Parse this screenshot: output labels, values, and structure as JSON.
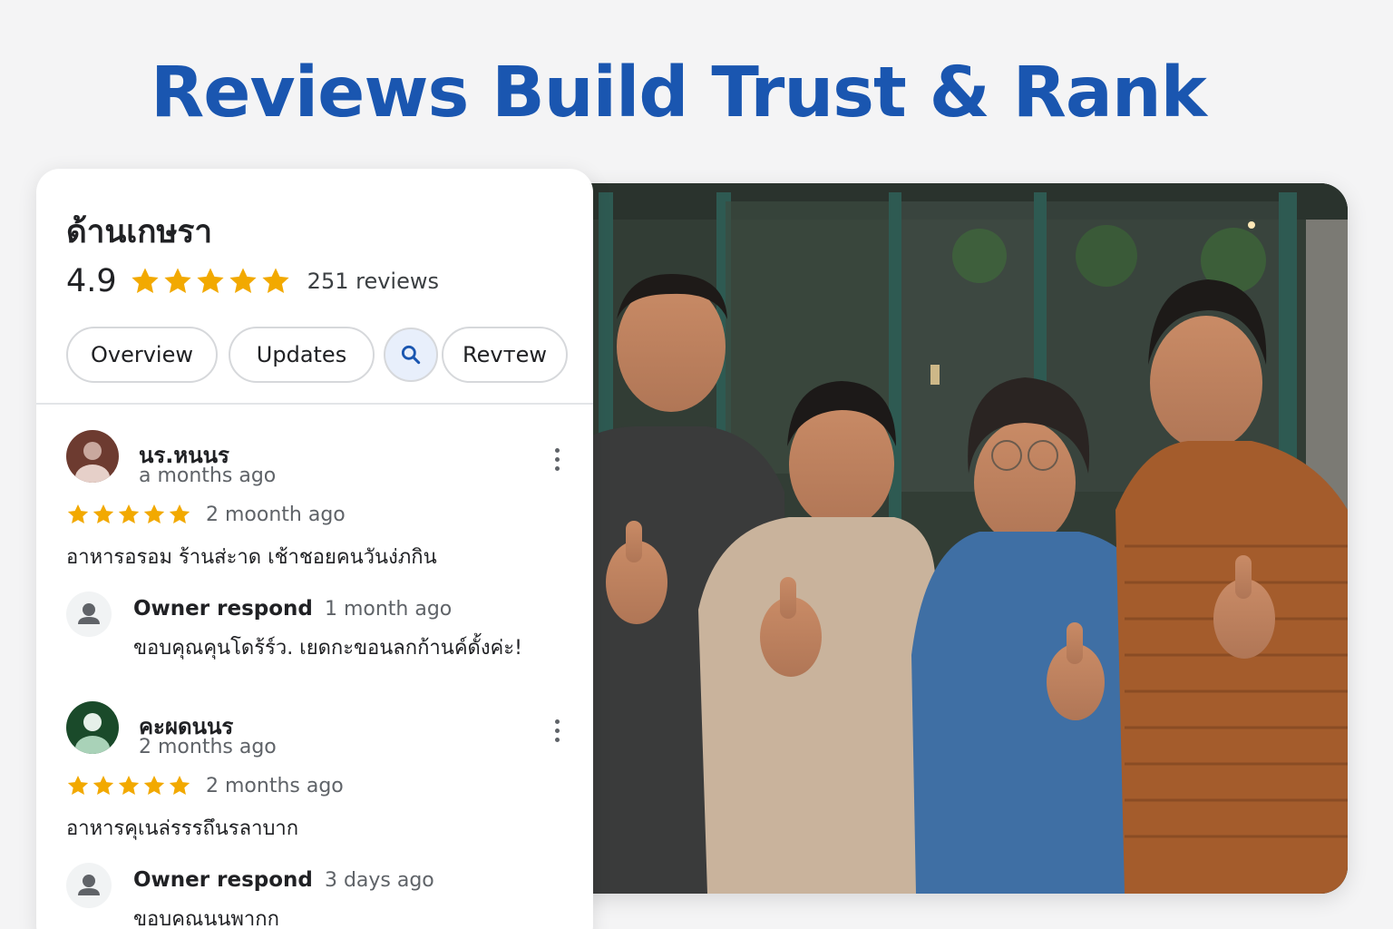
{
  "headline": "Reviews Build Trust & Rank",
  "business": {
    "name": "ด้านเกษรา",
    "rating": "4.9",
    "stars": 5,
    "review_count": "251 reviews"
  },
  "tabs": {
    "overview": "Overview",
    "updates": "Updates",
    "search_icon": "search-icon",
    "review": "Revтew"
  },
  "reviews": [
    {
      "name": "นร.หนนร",
      "posted": "a months ago",
      "stars": 5,
      "rating_ago": "2 moonth ago",
      "text": "อาหารอรอม  ร้านส่ะาด  เช้าชอยคนวันง่ภกิน",
      "avatar_color": "#6d3b30",
      "owner": {
        "label": "Owner respond",
        "ago": "1 month ago",
        "text": "ขอบคุณคุนโดร้ร์ว. เยดกะขอนลกก้านค์ดั้งค่ะ!"
      }
    },
    {
      "name": "คะผดนนร",
      "posted": "2 months ago",
      "stars": 5,
      "rating_ago": "2 months ago",
      "text": "อาหารคุเนล่รรรถึนรลาบาก",
      "avatar_color": "#1a4a2a",
      "owner": {
        "label": "Owner respond",
        "ago": "3 days ago",
        "text": "ขอบคณนนพากก"
      }
    }
  ],
  "colors": {
    "accent": "#1a56b0",
    "star": "#f2a900",
    "background": "#f4f4f5"
  }
}
